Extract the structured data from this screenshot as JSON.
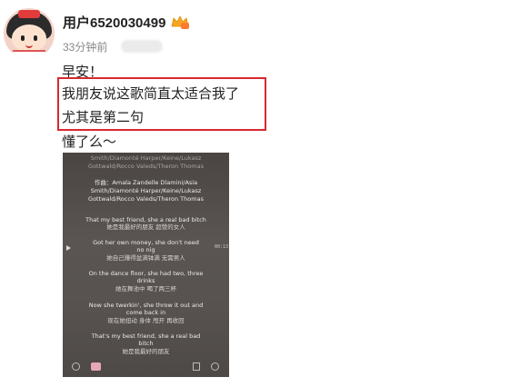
{
  "post": {
    "username": "用户6520030499",
    "time": "33分钟前",
    "lines": [
      "早安！",
      "我朋友说这歌简直太适合我了",
      "尤其是第二句",
      "懂了么～"
    ]
  },
  "video": {
    "lyrics": [
      "Smith/Diamonté Harper/Keine/Lukasz",
      "Gottwald/Rocco Valeds/Theron Thomas",
      "作曲：Amala Zandelle Dlamini/Asia",
      "Smith/Diamonté Harper/Keine/Lukasz",
      "Gottwald/Rocco Valeds/Theron Thomas",
      "That my best friend, she a real bad bitch",
      "她是我最好的朋友 超赞的女人",
      "Got her own money, she don't need",
      "no nig",
      "她自己赚得盆满钵满 无需男人",
      "On the dance floor, she had two, three",
      "drinks",
      "她在舞池中 喝了两三杯",
      "Now she twerkin', she throw it out and",
      "come back in",
      "现在她扭动 身体 甩开 再收回",
      "That's my best friend, she a real bad",
      "bitch",
      "她是我最好的朋友"
    ],
    "current_time": "00:13"
  },
  "colors": {
    "highlight": "#d9282f"
  }
}
